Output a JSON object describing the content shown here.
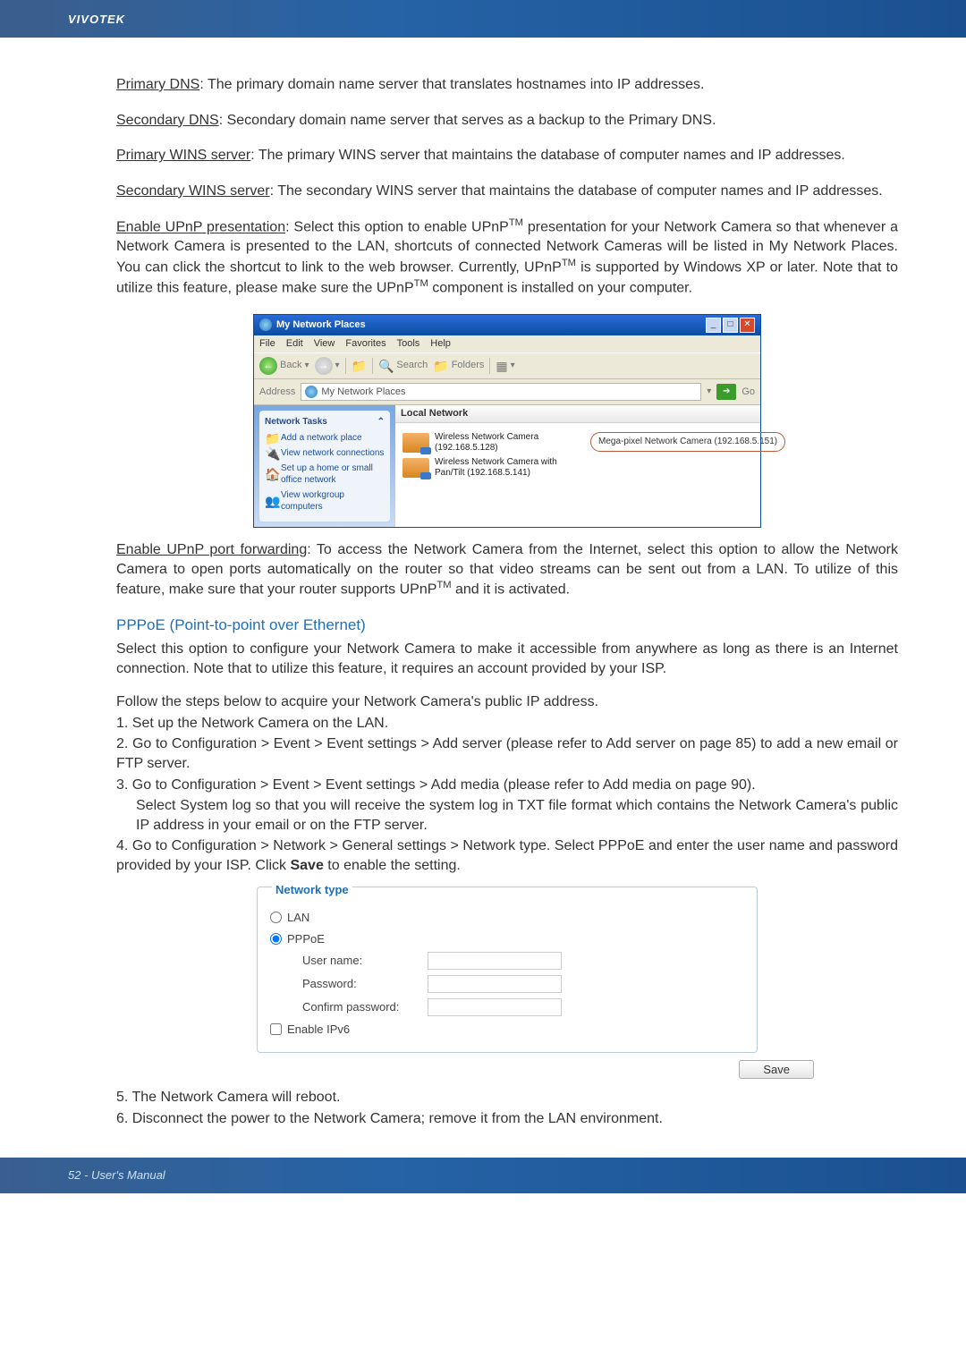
{
  "brand": "VIVOTEK",
  "p1_term": "Primary DNS",
  "p1_text": ": The primary domain name server that translates hostnames into IP addresses.",
  "p2_term": "Secondary DNS",
  "p2_text": ": Secondary domain name server that serves as a backup to the Primary DNS.",
  "p3_term": "Primary WINS server",
  "p3_text": ": The primary WINS server that maintains the database of computer names and IP addresses.",
  "p4_term": "Secondary WINS server",
  "p4_text": ": The secondary WINS server that maintains the database of computer names and IP addresses.",
  "p5_term": "Enable UPnP presentation",
  "p5_text_a": ": Select this option to enable UPnP",
  "p5_tm1": "TM",
  "p5_text_b": " presentation for your Network Camera so that whenever a Network Camera is presented to the LAN, shortcuts of connected Network Cameras will be listed in My Network Places. You can click the shortcut to link to the web browser. Currently, UPnP",
  "p5_tm2": "TM",
  "p5_text_c": " is supported by Windows XP or later. Note that to utilize this feature, please make sure the UPnP",
  "p5_tm3": "TM",
  "p5_text_d": " component is installed on your computer.",
  "xp": {
    "title": "My Network Places",
    "menu": {
      "file": "File",
      "edit": "Edit",
      "view": "View",
      "fav": "Favorites",
      "tools": "Tools",
      "help": "Help"
    },
    "tb": {
      "back": "Back",
      "search": "Search",
      "folders": "Folders"
    },
    "addr_label": "Address",
    "addr_value": "My Network Places",
    "go": "Go",
    "side_title": "Network Tasks",
    "side_links": {
      "a": "Add a network place",
      "b": "View network connections",
      "c": "Set up a home or small office network",
      "d": "View workgroup computers"
    },
    "local_network": "Local Network",
    "dev1_name": "Wireless Network Camera",
    "dev1_ip": "(192.168.5.128)",
    "dev2_name": "Wireless Network Camera with Pan/Tilt (192.168.5.141)",
    "callout": "Mega-pixel Network Camera (192.168.5.151)"
  },
  "p6_term": "Enable UPnP port forwarding",
  "p6_text_a": ": To access the Network Camera from the Internet, select this option to allow the Network Camera to open ports automatically on the router so that video streams can be sent out from a LAN. To utilize of this feature, make sure that your router supports UPnP",
  "p6_tm": "TM",
  "p6_text_b": " and it is activated.",
  "pppoe_heading": "PPPoE (Point-to-point over Ethernet)",
  "pppoe_intro": "Select this option to configure your Network Camera to make it accessible from anywhere as long as there is an Internet connection. Note that to utilize this feature, it requires an account provided by your ISP.",
  "follow": "Follow the steps below to acquire your Network Camera's public IP address.",
  "s1": "1. Set up the Network Camera on the LAN.",
  "s2": "2. Go to Configuration > Event > Event settings > Add server (please refer to Add server on page 85) to add a new email or FTP server.",
  "s3": "3. Go to Configuration > Event > Event settings > Add media (please refer to Add media on page 90).",
  "s3b": "Select System log so that you will receive the system log in TXT file format which contains the Network Camera's public IP address in your email or on the FTP server.",
  "s4a": "4. Go to Configuration > Network > General settings > Network type. Select PPPoE and enter the user name and password provided by your ISP. Click ",
  "s4b_bold": "Save",
  "s4c": " to enable the setting.",
  "panel": {
    "legend": "Network type",
    "lan": "LAN",
    "pppoe": "PPPoE",
    "user": "User name:",
    "pass": "Password:",
    "confirm": "Confirm password:",
    "ipv6": "Enable IPv6",
    "save": "Save"
  },
  "s5": "5. The Network Camera will reboot.",
  "s6": "6. Disconnect the power to the Network Camera; remove it from the LAN environment.",
  "footer": "52 - User's Manual"
}
